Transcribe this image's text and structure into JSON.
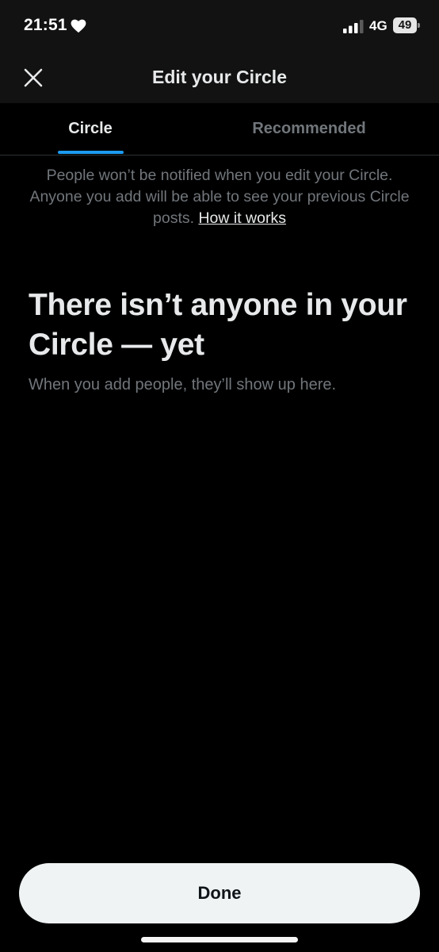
{
  "status_bar": {
    "time": "21:51",
    "network": "4G",
    "battery": "49"
  },
  "header": {
    "title": "Edit your Circle",
    "close_icon": "close-icon"
  },
  "tabs": [
    {
      "label": "Circle",
      "active": true
    },
    {
      "label": "Recommended",
      "active": false
    }
  ],
  "info": {
    "text": "People won’t be notified when you edit your Circle. Anyone you add will be able to see your previous Circle posts.",
    "link_label": "How it works"
  },
  "empty_state": {
    "title": "There isn’t anyone in your Circle — yet",
    "subtitle": "When you add people, they’ll show up here."
  },
  "footer": {
    "done_label": "Done"
  },
  "colors": {
    "accent": "#1d9bf0",
    "background": "#000000",
    "header_background": "#121212",
    "muted_text": "#71767b",
    "button_background": "#eff3f4"
  }
}
